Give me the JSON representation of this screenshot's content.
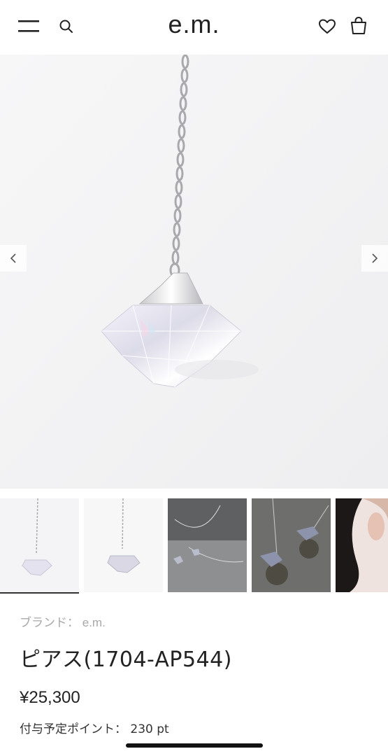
{
  "header": {
    "logo": "e.m.",
    "menu_icon": "hamburger-menu-icon",
    "search_icon": "search-icon",
    "favorite_icon": "heart-icon",
    "bag_icon": "shopping-bag-icon"
  },
  "gallery": {
    "prev_icon": "chevron-left-icon",
    "next_icon": "chevron-right-icon",
    "active_thumbnail": 1,
    "thumbnail_count_visible": 5
  },
  "product": {
    "brand_label": "ブランド：",
    "brand_name": "e.m.",
    "name": "ピアス(1704-AP544)",
    "price": "¥25,300",
    "points_label": "付与予定ポイント：",
    "points_value": "230 pt"
  },
  "colors": {
    "text": "#222222",
    "muted": "#a8a8a8",
    "background": "#ffffff"
  }
}
